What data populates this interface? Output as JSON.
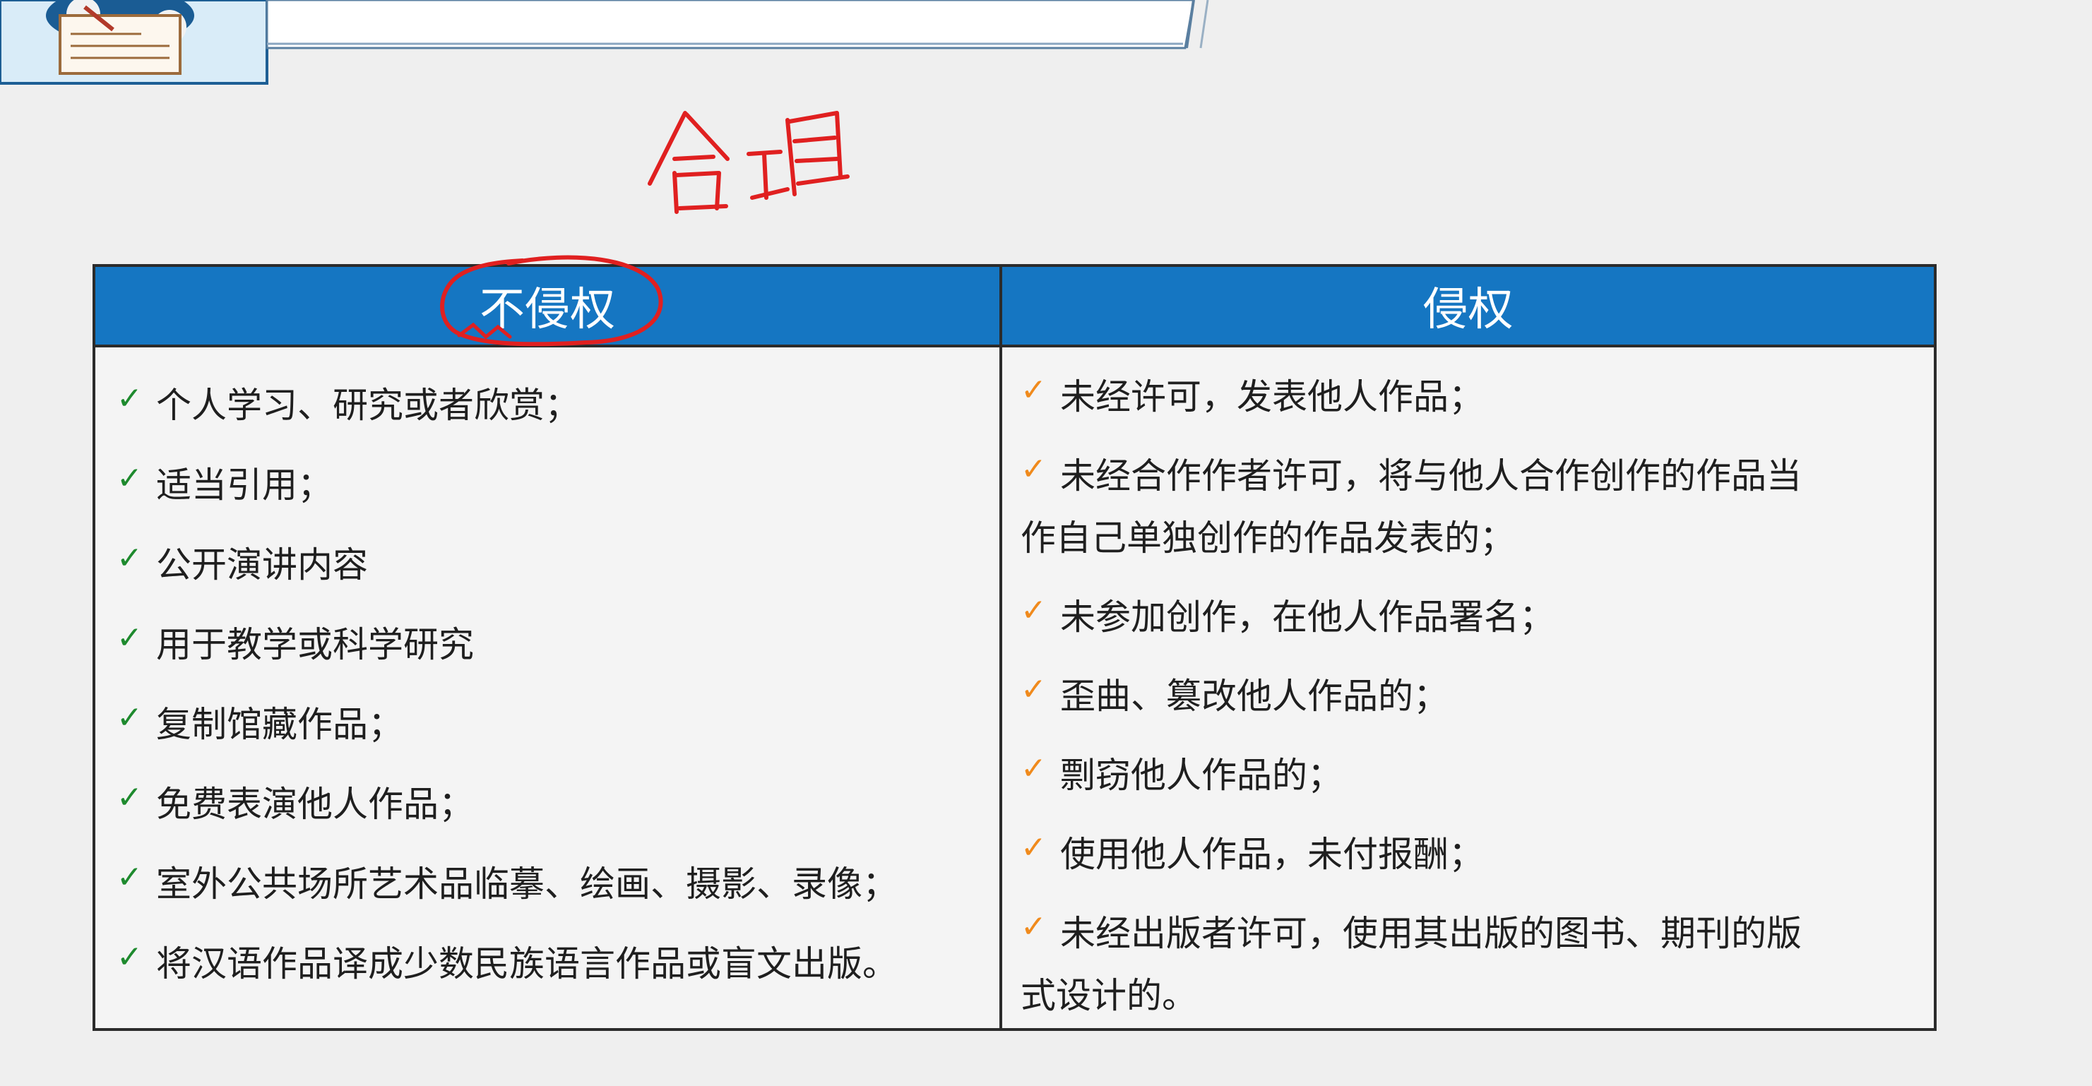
{
  "annotation": {
    "handwritten_text": "合理"
  },
  "table": {
    "left_header": "不侵权",
    "right_header": "侵权",
    "left_items": [
      "个人学习、研究或者欣赏；",
      "适当引用；",
      "公开演讲内容",
      "用于教学或科学研究",
      "复制馆藏作品；",
      "免费表演他人作品；",
      "室外公共场所艺术品临摹、绘画、摄影、录像；",
      "将汉语作品译成少数民族语言作品或盲文出版。"
    ],
    "right_items": [
      {
        "line1": "未经许可，发表他人作品；",
        "line2": ""
      },
      {
        "line1": "未经合作作者许可，将与他人合作创作的作品当",
        "line2": "作自己单独创作的作品发表的；"
      },
      {
        "line1": "未参加创作，在他人作品署名；",
        "line2": ""
      },
      {
        "line1": "歪曲、篡改他人作品的；",
        "line2": ""
      },
      {
        "line1": "剽窃他人作品的；",
        "line2": ""
      },
      {
        "line1": "使用他人作品，未付报酬；",
        "line2": ""
      },
      {
        "line1": "未经出版者许可，使用其出版的图书、期刊的版",
        "line2": "式设计的。"
      }
    ],
    "check_symbol": "✓",
    "colors": {
      "header_bg": "#1576c2",
      "left_check": "#1e8a2e",
      "right_check": "#f08a1c",
      "annotation_red": "#e02020"
    }
  }
}
